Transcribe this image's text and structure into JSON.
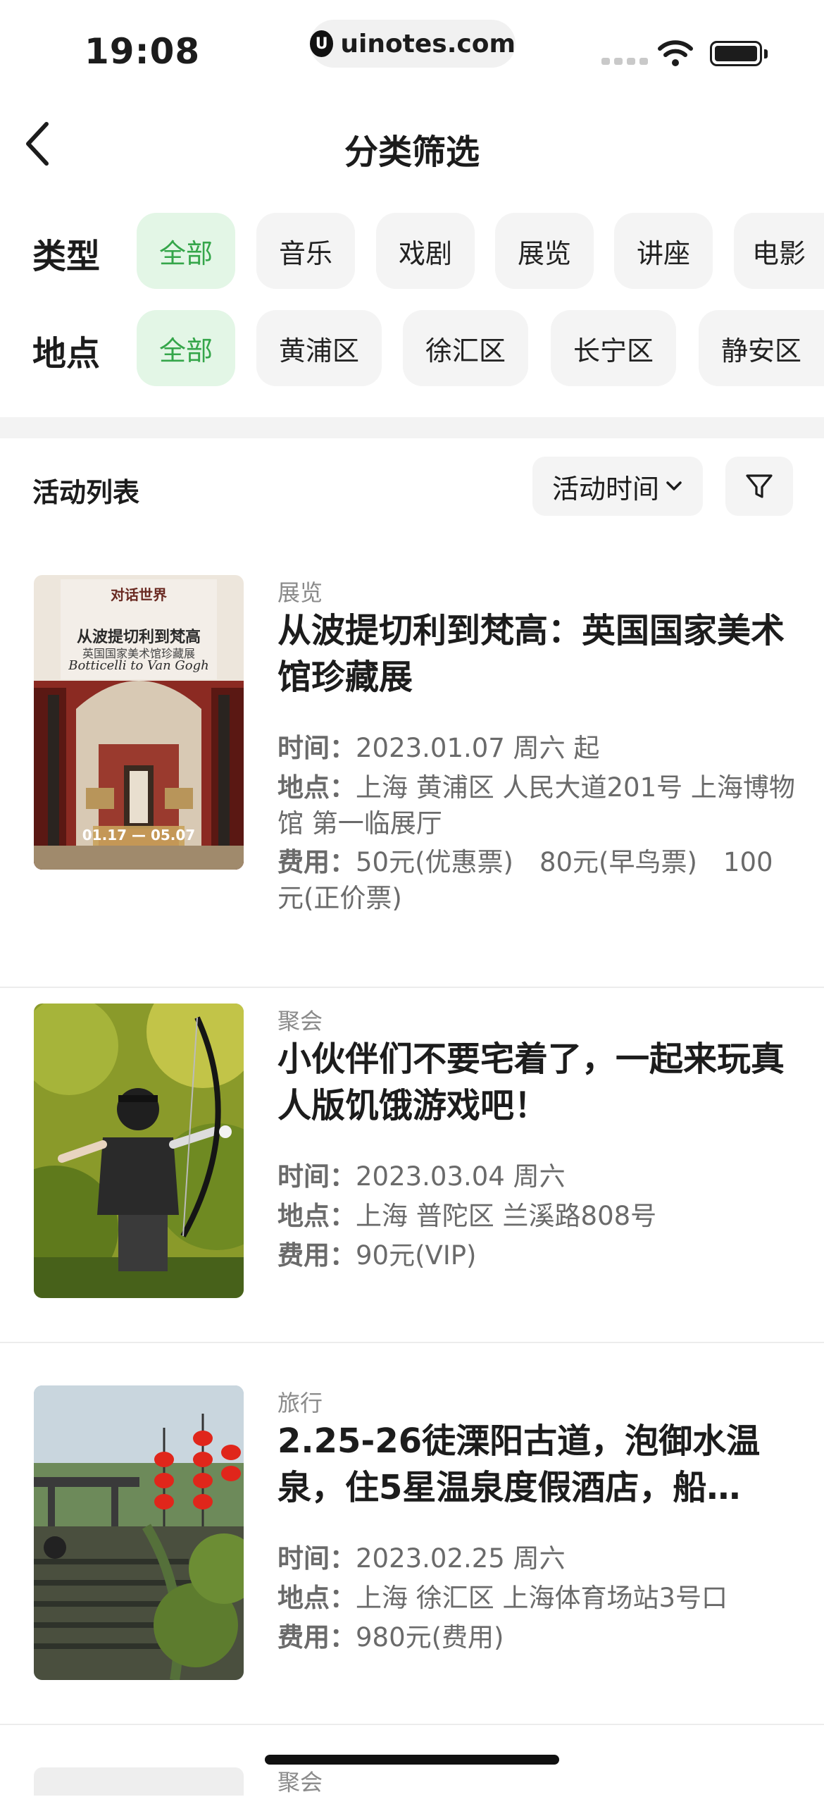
{
  "status_bar": {
    "time": "19:08",
    "url": "uinotes.com",
    "url_logo": "U"
  },
  "nav": {
    "title": "分类筛选"
  },
  "filters": {
    "type": {
      "label": "类型",
      "options": [
        "全部",
        "音乐",
        "戏剧",
        "展览",
        "讲座",
        "电影"
      ],
      "selected": "全部"
    },
    "location": {
      "label": "地点",
      "options": [
        "全部",
        "黄浦区",
        "徐汇区",
        "长宁区",
        "静安区"
      ],
      "selected": "全部"
    }
  },
  "list": {
    "title": "活动列表",
    "sort_label": "活动时间"
  },
  "events": [
    {
      "category": "展览",
      "title": "从波提切利到梵高：英国国家美术馆珍藏展",
      "time_label": "时间：",
      "time": "2023.01.07 周六 起",
      "place_label": "地点：",
      "place": "上海 黄浦区 人民大道201号 上海博物馆 第一临展厅",
      "fee_label": "费用：",
      "fee": "50元(优惠票)　80元(早鸟票)　100元(正价票)",
      "poster": {
        "top_text": "对话世界",
        "title_cn": "从波提切利到梵高",
        "subtitle_cn": "英国国家美术馆珍藏展",
        "title_en": "Botticelli to Van Gogh",
        "dates": "01.17 — 05.07"
      }
    },
    {
      "category": "聚会",
      "title": "小伙伴们不要宅着了，一起来玩真人版饥饿游戏吧！",
      "time_label": "时间：",
      "time": "2023.03.04 周六",
      "place_label": "地点：",
      "place": "上海 普陀区 兰溪路808号",
      "fee_label": "费用：",
      "fee": "90元(VIP)"
    },
    {
      "category": "旅行",
      "title": "2.25-26徒溧阳古道，泡御水温泉，住5星温泉度假酒店，船…",
      "time_label": "时间：",
      "time": "2023.02.25 周六",
      "place_label": "地点：",
      "place": "上海 徐汇区 上海体育场站3号口",
      "fee_label": "费用：",
      "fee": "980元(费用)"
    }
  ],
  "peek_next": {
    "category": "聚会"
  },
  "colors": {
    "accent_green": "#35a64a",
    "chip_active_bg": "#e3f6e6",
    "chip_bg": "#f4f4f4"
  }
}
